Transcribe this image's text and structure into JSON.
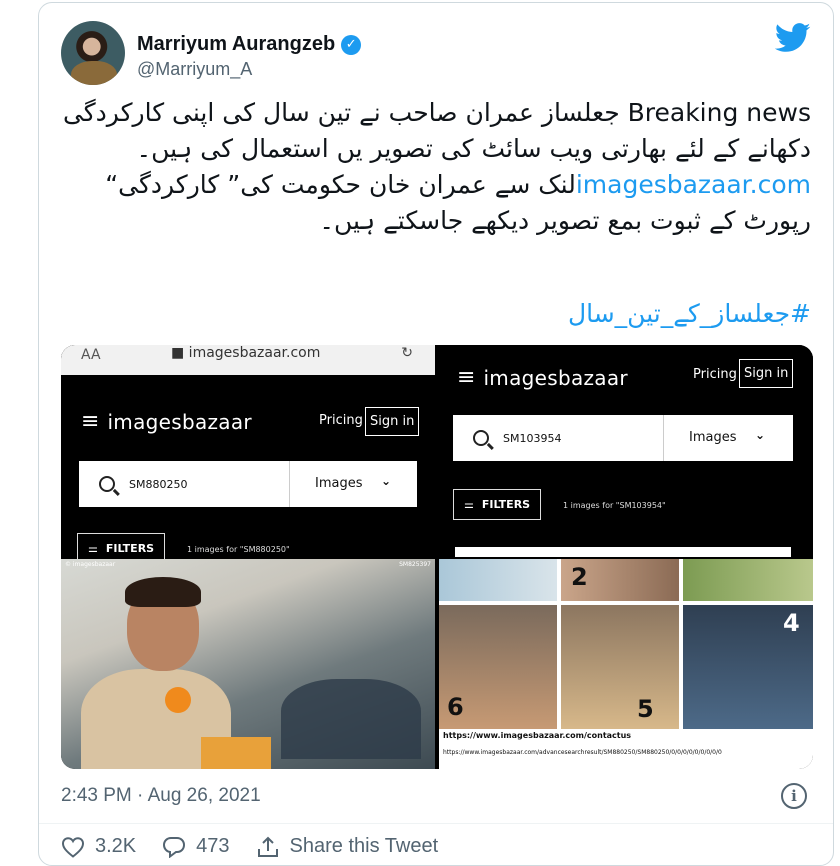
{
  "tweet": {
    "author_name": "Marriyum Aurangzeb",
    "handle": "@Marriyum_A",
    "text_part1": "Breaking news جعلساز عمران صاحب نے تین سال کی اپنی کارکردگی دکھانے کے لئے بھارتی ویب سائٹ کی تصویر یں استعمال کی ہیں۔ ",
    "text_link": "imagesbazaar.com",
    "text_part2": "لنک سے عمران خان حکومت کی” کارکردگی“ رپورٹ کے ثبوت بمع تصویر دیکھے جاسکتے ہیں۔",
    "hashtag": "#جعلساز_کے_تین_سال",
    "timestamp": "2:43 PM · Aug 26, 2021",
    "likes": "3.2K",
    "replies": "473",
    "share_label": "Share this Tweet",
    "brand_color": "#1d9bf0"
  },
  "media": {
    "left_panel": {
      "browser_aa": "AA",
      "browser_url": "■ imagesbazaar.com",
      "brand": "imagesbazaar",
      "pricing": "Pricing",
      "signin": "Sign in",
      "search_term": "SM880250",
      "images_select": "Images",
      "filters": "FILTERS",
      "result_count": "1 images for \"SM880250\"",
      "watermark_left": "© imagesbazaar",
      "watermark_right": "SM825397"
    },
    "right_panel": {
      "brand": "imagesbazaar",
      "pricing": "Pricing",
      "signin": "Sign in",
      "search_term": "SM103954",
      "images_select": "Images",
      "filters": "FILTERS",
      "result_count": "1 images for \"SM103954\""
    },
    "collage": {
      "numbers": [
        "2",
        "4",
        "6",
        "5"
      ],
      "url_main": "https://www.imagesbazaar.com/contactus",
      "url_detail": "https://www.imagesbazaar.com/advancesearchresult/SM880250/SM880250/0/0/0/0/0/0/0/0/0"
    }
  }
}
